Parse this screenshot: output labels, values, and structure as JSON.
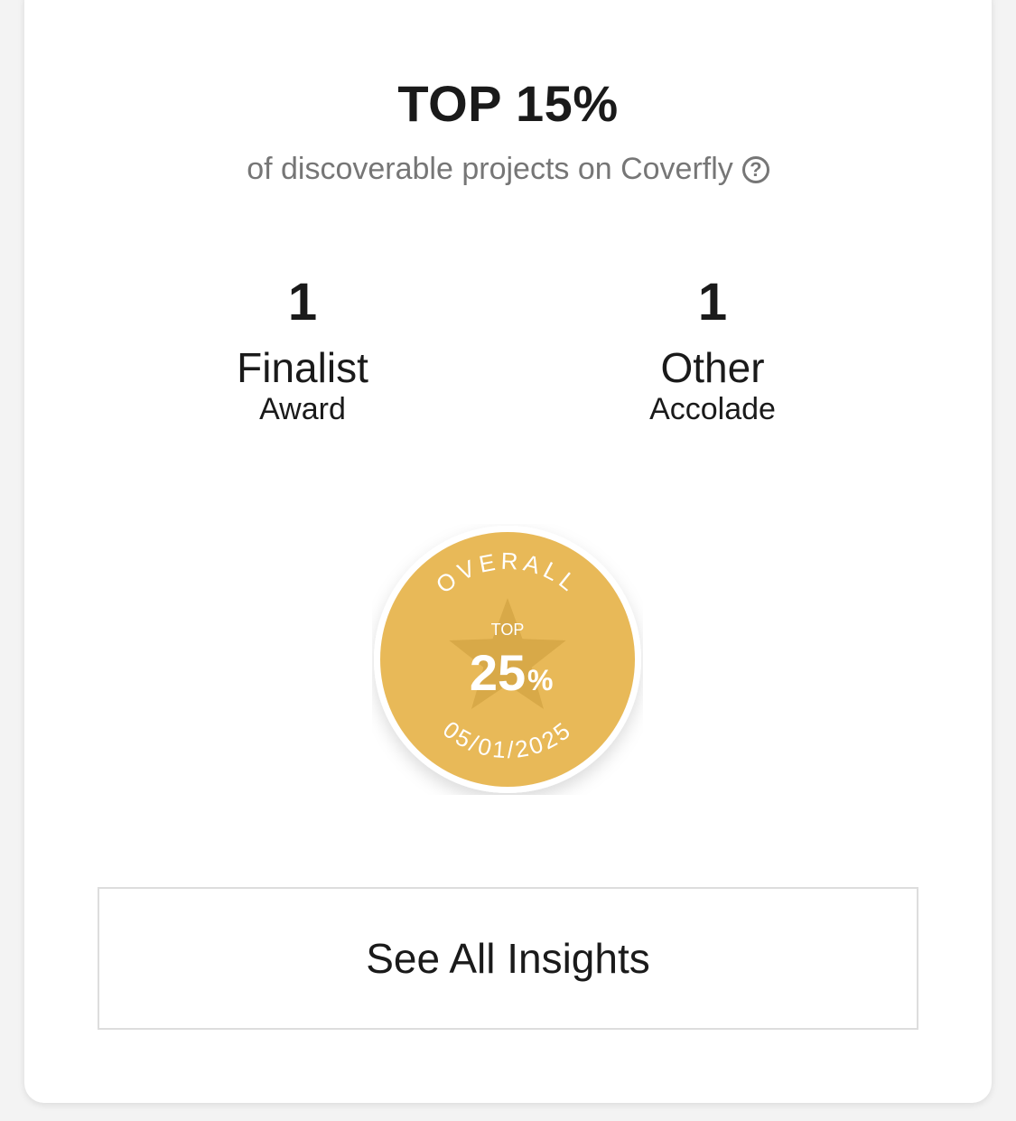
{
  "ranking": {
    "headline": "TOP 15%",
    "subtitle": "of discoverable projects on Coverfly",
    "help_icon": "question-circle-icon"
  },
  "stats": [
    {
      "count": "1",
      "type": "Finalist",
      "kind": "Award"
    },
    {
      "count": "1",
      "type": "Other",
      "kind": "Accolade"
    }
  ],
  "badge": {
    "arc_top": "OVERALL",
    "small_label": "TOP",
    "value": "25",
    "unit": "%",
    "arc_bottom": "05/01/2025",
    "gold_color": "#e8b958",
    "star_color": "#d8a948"
  },
  "insights_button": {
    "label": "See All Insights"
  }
}
